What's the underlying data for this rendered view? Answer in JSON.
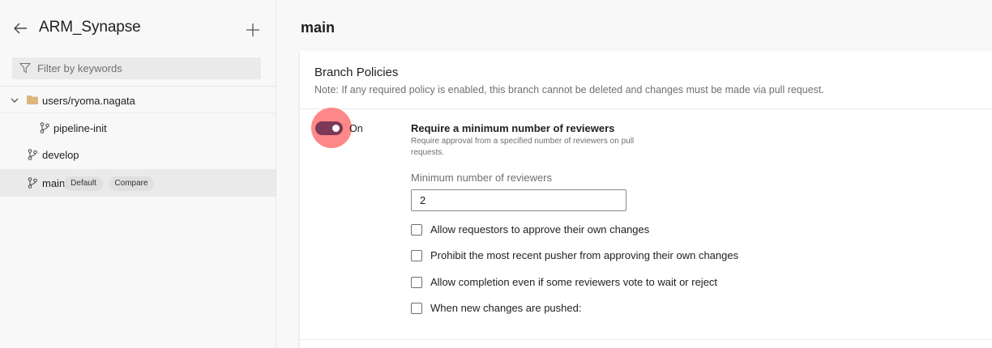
{
  "sidebar": {
    "repo_title": "ARM_Synapse",
    "filter_placeholder": "Filter by keywords",
    "tree": [
      {
        "label": "users/ryoma.nagata",
        "type": "folder",
        "expanded": true
      },
      {
        "label": "pipeline-init",
        "type": "branch"
      },
      {
        "label": "develop",
        "type": "branch"
      },
      {
        "label": "main",
        "type": "branch",
        "selected": true,
        "badges": [
          "Default",
          "Compare"
        ]
      }
    ]
  },
  "main": {
    "title": "main",
    "card": {
      "title": "Branch Policies",
      "note": "Note: If any required policy is enabled, this branch cannot be deleted and changes must be made via pull request.",
      "toggle_label": "On",
      "toggle_on": true,
      "policy_title": "Require a minimum number of reviewers",
      "policy_desc": "Require approval from a specified number of reviewers on pull requests.",
      "field_label": "Minimum number of reviewers",
      "field_value": "2",
      "checkboxes": [
        {
          "label": "Allow requestors to approve their own changes",
          "checked": false
        },
        {
          "label": "Prohibit the most recent pusher from approving their own changes",
          "checked": false
        },
        {
          "label": "Allow completion even if some reviewers vote to wait or reject",
          "checked": false
        },
        {
          "label": "When new changes are pushed:",
          "checked": false
        }
      ]
    }
  },
  "colors": {
    "toggle_on": "#7c3858",
    "highlight": "#ff7878",
    "folder": "#dcb67a"
  },
  "icons": [
    "back-arrow-icon",
    "plus-icon",
    "filter-icon",
    "chevron-down-icon",
    "folder-icon",
    "branch-icon"
  ]
}
